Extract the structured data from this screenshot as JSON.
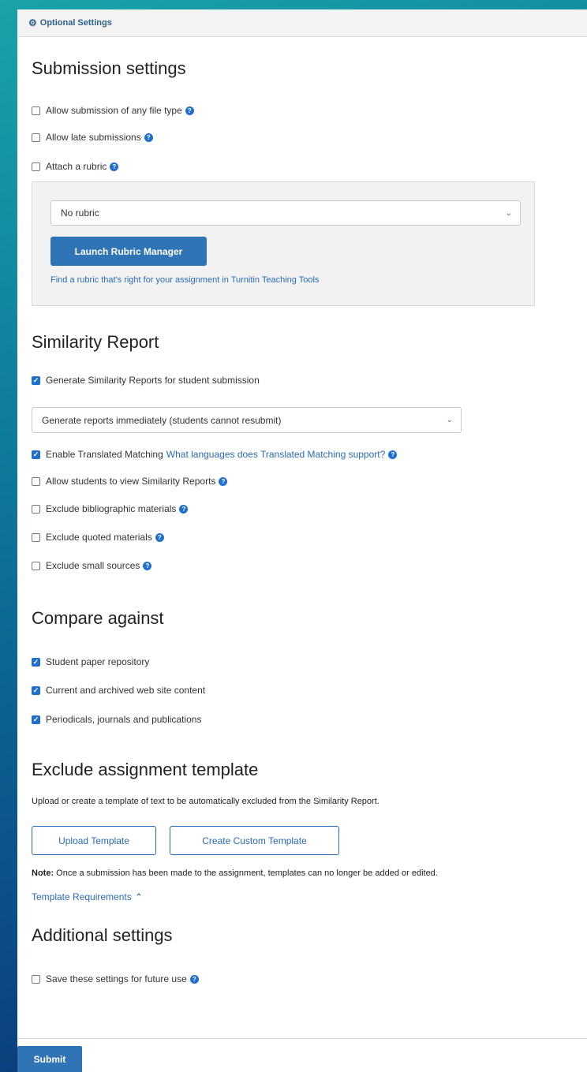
{
  "header": {
    "gear_icon": "gear-icon",
    "title": "Optional Settings"
  },
  "submission": {
    "heading": "Submission settings",
    "options": [
      {
        "label": "Allow submission of any file type",
        "checked": false,
        "help": true
      },
      {
        "label": "Allow late submissions",
        "checked": false,
        "help": true
      },
      {
        "label": "Attach a rubric",
        "checked": false,
        "help": true
      }
    ],
    "rubric_select_value": "No rubric",
    "launch_button": "Launch Rubric Manager",
    "rubric_link": "Find a rubric that's right for your assignment in Turnitin Teaching Tools"
  },
  "similarity": {
    "heading": "Similarity Report",
    "generate_label": "Generate Similarity Reports for student submission",
    "report_select_value": "Generate reports immediately (students cannot resubmit)",
    "translated_label": "Enable Translated Matching",
    "translated_link": "What languages does Translated Matching support?",
    "options": [
      {
        "label": "Allow students to view Similarity Reports",
        "checked": false
      },
      {
        "label": "Exclude bibliographic materials",
        "checked": false
      },
      {
        "label": "Exclude quoted materials",
        "checked": false
      },
      {
        "label": "Exclude small sources",
        "checked": false
      }
    ]
  },
  "compare": {
    "heading": "Compare against",
    "options": [
      {
        "label": "Student paper repository",
        "checked": true
      },
      {
        "label": "Current and archived web site content",
        "checked": true
      },
      {
        "label": "Periodicals, journals and publications",
        "checked": true
      }
    ]
  },
  "template": {
    "heading": "Exclude assignment template",
    "description": "Upload or create a template of text to be automatically excluded from the Similarity Report.",
    "upload_button": "Upload Template",
    "create_button": "Create Custom Template",
    "note_label": "Note:",
    "note_text": " Once a submission has been made to the assignment, templates can no longer be added or edited.",
    "requirements_link": "Template Requirements"
  },
  "additional": {
    "heading": "Additional settings",
    "save_label": "Save these settings for future use"
  },
  "footer": {
    "submit_label": "Submit"
  },
  "colors": {
    "accent": "#2f74b5",
    "link": "#2a6bb5",
    "checkbox": "#1f6fd1"
  }
}
